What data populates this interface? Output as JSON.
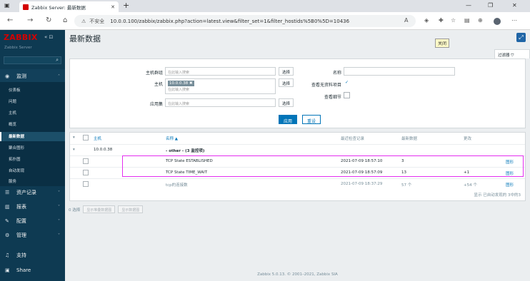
{
  "browser": {
    "tab_title": "Zabbix Server: 最新数据",
    "url_warning": "不安全",
    "url": "10.0.0.100/zabbix/zabbix.php?action=latest.view&filter_set=1&filter_hostids%5B0%5D=10436"
  },
  "sidebar": {
    "logo": "ZABBIX",
    "server_name": "Zabbix Server",
    "menu": [
      {
        "label": "监测",
        "icon": "eye-icon"
      },
      {
        "label": "资产记录",
        "icon": "list-icon"
      },
      {
        "label": "报表",
        "icon": "chart-icon"
      },
      {
        "label": "配置",
        "icon": "wrench-icon"
      },
      {
        "label": "管理",
        "icon": "gear-icon"
      },
      {
        "label": "支持",
        "icon": "headset-icon"
      },
      {
        "label": "Share",
        "icon": "share-icon"
      }
    ],
    "submenu": [
      "仪表板",
      "问题",
      "主机",
      "概览",
      "最新数据",
      "聚合图形",
      "拓扑图",
      "自动发现",
      "服务"
    ],
    "active_submenu": "最新数据"
  },
  "main": {
    "title": "最新数据",
    "tooltip": "关闭",
    "filter_tab": "过滤器",
    "filter": {
      "host_group_label": "主机群组",
      "host_label": "主机",
      "app_label": "应用集",
      "placeholder": "在此输入搜索",
      "select_label": "选择",
      "host_tag": "10.0.0.38",
      "name_label": "名称",
      "show_no_data_label": "查看无资料项目",
      "show_details_label": "查看细节",
      "apply": "应用",
      "reset": "重设"
    },
    "table": {
      "headers": {
        "host": "主机",
        "name": "名称 ▲",
        "last_check": "最近检查记录",
        "last_value": "最新数据",
        "change": "更改"
      },
      "group_host": "10.0.0.38",
      "group_name": "- other - (3 监控项)",
      "rows": [
        {
          "name": "TCP State ESTABLISHED",
          "last_check": "2021-07-09 18:57:10",
          "last_value": "3",
          "change": "",
          "action": "图形"
        },
        {
          "name": "TCP State TIME_WAIT",
          "last_check": "2021-07-09 18:57:09",
          "last_value": "13",
          "change": "+1",
          "action": "图形"
        },
        {
          "name": "tcp的连接数",
          "last_check": "2021-07-09 18:37:29",
          "last_value": "57 个",
          "change": "+54 个",
          "action": "图形"
        }
      ],
      "footer": "显示 已自动发现的 3中的3"
    },
    "actions": {
      "selected": "0 选择",
      "btn1": "显示堆叠数据图",
      "btn2": "显示数据图"
    },
    "copyright": "Zabbix 5.0.13. © 2001–2021, Zabbix SIA"
  }
}
